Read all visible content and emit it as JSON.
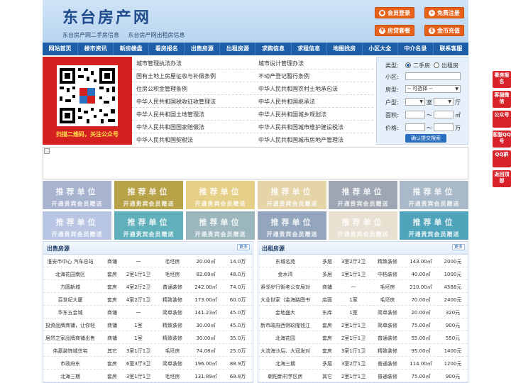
{
  "header": {
    "title": "东台房产网",
    "sub_links": [
      "东台房产网二手房信息",
      "东台房产网出租房信息"
    ],
    "buttons": [
      {
        "label": "会员登录",
        "icon": "user-icon"
      },
      {
        "label": "免费注册",
        "icon": "register-icon"
      },
      {
        "label": "房贷套餐",
        "icon": "loan-icon"
      },
      {
        "label": "金币充值",
        "icon": "coin-icon"
      }
    ]
  },
  "nav": [
    "网站首页",
    "楼市资讯",
    "新房楼盘",
    "看房报名",
    "出售房源",
    "出租房源",
    "求购信息",
    "求租信息",
    "地图找房",
    "小区大全",
    "中介名录",
    "联系客服"
  ],
  "qr": {
    "caption": "扫描二维码，关注公众号"
  },
  "links": {
    "left": [
      "城市管理执法办法",
      "国有土地上房屋征收与补偿条例",
      "住房公积金管理条例",
      "中华人民共和国税收征收管理法",
      "中华人民共和国土地管理法",
      "中华人民共和国国家赔偿法",
      "中华人民共和国契税法"
    ],
    "right": [
      "城市设计管理办法",
      "不动产登记暂行条例",
      "中华人民共和国农村土地承包法",
      "中华人民共和国继承法",
      "中华人民共和国城乡规划法",
      "中华人民共和国城市维护建设税法",
      "中华人民共和国城市房地产管理法"
    ]
  },
  "search": {
    "type_label": "类型:",
    "type_options": [
      "二手房",
      "出租房"
    ],
    "selected": "二手房",
    "community_label": "小区:",
    "community_value": "",
    "house_type_label": "房型:",
    "house_type_value": "-- 可选择 --",
    "layout_label": "户型:",
    "room_unit": "室",
    "hall_unit": "厅",
    "area_label": "面积:",
    "area_unit": "㎡",
    "range_sep": "～",
    "price_label": "价格:",
    "price_unit": "万",
    "submit_label": "确认提交搜索"
  },
  "tiles": {
    "title": "推荐单位",
    "subtitle": "开通贵宾会员赠送",
    "colors": [
      "#a7b3cf",
      "#b8a248",
      "#e6cf86",
      "#e4d4a8",
      "#9ea6b3",
      "#a9b9c9",
      "#b8c6e3",
      "#5fb0ba",
      "#9cb6be",
      "#93a6bd",
      "#e8e1d2",
      "#4fa4bb"
    ]
  },
  "sale": {
    "title": "出售房源",
    "more": "更多",
    "rows": [
      [
        "淮安市中心 汽车总站",
        "商铺",
        "一",
        "毛坯房",
        "20.00㎡",
        "14.0万"
      ],
      [
        "北海花园南区",
        "套房",
        "2室1厅1卫",
        "毛坯房",
        "82.69㎡",
        "48.0万"
      ],
      [
        "方圆新城",
        "套房",
        "4室2厅2卫",
        "普通装修",
        "242.00㎡",
        "74.0万"
      ],
      [
        "百世纪大厦",
        "套房",
        "4室2厅1卫",
        "精致装修",
        "173.00㎡",
        "60.0万"
      ],
      [
        "华东五金城",
        "商铺",
        "一",
        "简单装修",
        "141.23㎡",
        "45.0万"
      ],
      [
        "投资品牌商铺，让你轻",
        "商铺",
        "1室",
        "精致装修",
        "30.00㎡",
        "45.0万"
      ],
      [
        "居然之家品牌商铺出售",
        "商铺",
        "1室",
        "精致装修",
        "30.00㎡",
        "35.0万"
      ],
      [
        "伟嘉装饰城住宅",
        "其它",
        "3室1厅1卫",
        "毛坯房",
        "74.08㎡",
        "25.0万"
      ],
      [
        "市政府东",
        "套房",
        "6室3厅3卫",
        "简单装修",
        "196.00㎡",
        "88.9万"
      ],
      [
        "北海三期",
        "套房",
        "3室1厅1卫",
        "毛坯房",
        "131.89㎡",
        "69.8万"
      ]
    ]
  },
  "rent": {
    "title": "出租房源",
    "more": "更多",
    "rows": [
      [
        "东城名苑",
        "多层",
        "3室2厅2卫",
        "精致装修",
        "143.00㎡",
        "2000元"
      ],
      [
        "金水湾",
        "多层",
        "1室1厅1卫",
        "中档装修",
        "40.00㎡",
        "1000元"
      ],
      [
        "紧邻步行街老公安局对",
        "商铺",
        "一",
        "毛坯房",
        "210.00㎡",
        "4588元"
      ],
      [
        "大业世家（金海路图书",
        "店面",
        "1室",
        "毛坯房",
        "70.00㎡",
        "2400元"
      ],
      [
        "金地盛大",
        "东库",
        "1室",
        "简单装修",
        "20.00㎡",
        "320元"
      ],
      [
        "新市政府西侧玖隆钱江",
        "套房",
        "2室1厅1卫",
        "简单装修",
        "75.00㎡",
        "900元"
      ],
      [
        "北海花园",
        "套房",
        "2室1厅1卫",
        "普通装修",
        "55.00㎡",
        "550元"
      ],
      [
        "大流海沙后、大冠发对",
        "套房",
        "3室1厅1卫",
        "精致装修",
        "95.00㎡",
        "1400元"
      ],
      [
        "北海三期",
        "多层",
        "3室2厅1卫",
        "普通装修",
        "114.00㎡",
        "1200元"
      ],
      [
        "朝阳新村学区房",
        "其它",
        "2室1厅1卫",
        "普通装修",
        "75.00㎡",
        "900元"
      ]
    ]
  },
  "side": [
    "看房报名",
    "客服微信",
    "公众号",
    "客服QQ号",
    "QQ群",
    "返回顶部"
  ]
}
